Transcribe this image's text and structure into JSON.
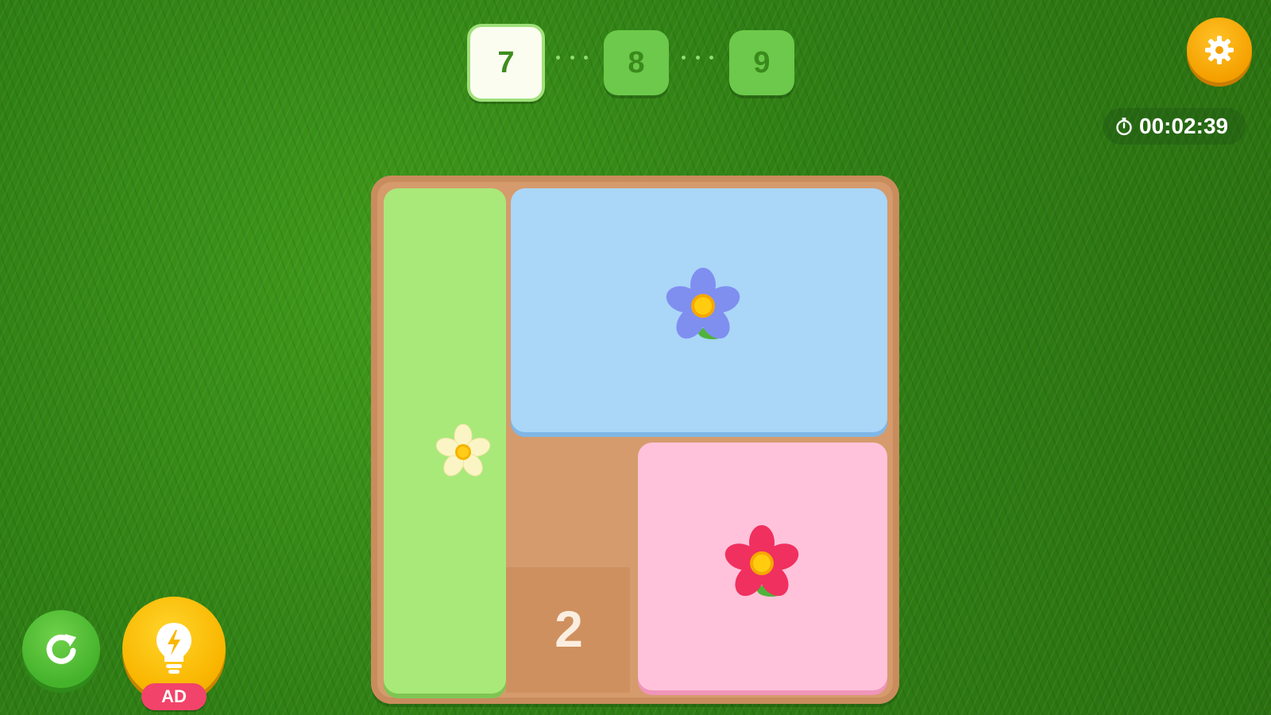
{
  "levels": {
    "current": "7",
    "next1": "8",
    "next2": "9"
  },
  "settings": {
    "icon": "gear-icon"
  },
  "timer": {
    "icon": "stopwatch-icon",
    "value": "00:02:39"
  },
  "board": {
    "pieces": [
      {
        "name": "green-block",
        "color": "#a9e97a",
        "flower_color": "#fbf5c5"
      },
      {
        "name": "blue-block",
        "color": "#aad6f8",
        "flower_color": "#7f8ff0"
      },
      {
        "name": "pink-block",
        "color": "#ffc2da",
        "flower_color": "#f0305f"
      }
    ],
    "empty_cell_count": "2"
  },
  "controls": {
    "restart_icon": "restart-icon",
    "hint_icon": "lightbulb-icon",
    "ad_label": "AD"
  },
  "colors": {
    "grass": "#2f7f14",
    "board": "#d59b6c",
    "accent_orange": "#f5a000",
    "accent_yellow": "#f9b600",
    "ad_pink": "#f2436a"
  }
}
